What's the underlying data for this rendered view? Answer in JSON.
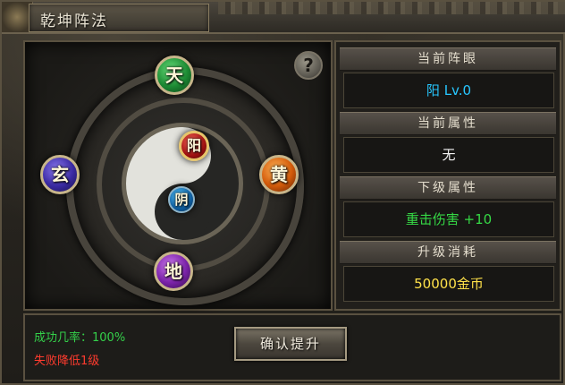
{
  "window": {
    "title": "乾坤阵法"
  },
  "formation": {
    "nodes": {
      "tian": "天",
      "xuan": "玄",
      "huang": "黄",
      "di": "地",
      "yang": "阳",
      "yin": "阴"
    },
    "help_label": "?"
  },
  "info": {
    "current_eye": {
      "label": "当前阵眼",
      "value": "阳 Lv.0",
      "color": "#27c7ff"
    },
    "current_attr": {
      "label": "当前属性",
      "value": "无",
      "color": "#f2f2f2"
    },
    "next_attr": {
      "label": "下级属性",
      "value": "重击伤害 +10",
      "color": "#35d845"
    },
    "upgrade_cost": {
      "label": "升级消耗",
      "value": "50000金币",
      "color": "#ffe24a"
    }
  },
  "footer": {
    "success_rate": "成功几率：100%",
    "fail_note": "失败降低1级",
    "confirm_label": "确认提升"
  },
  "colors": {
    "success": "#34d04a",
    "fail": "#ff3b2e",
    "frame": "#5a5140"
  }
}
